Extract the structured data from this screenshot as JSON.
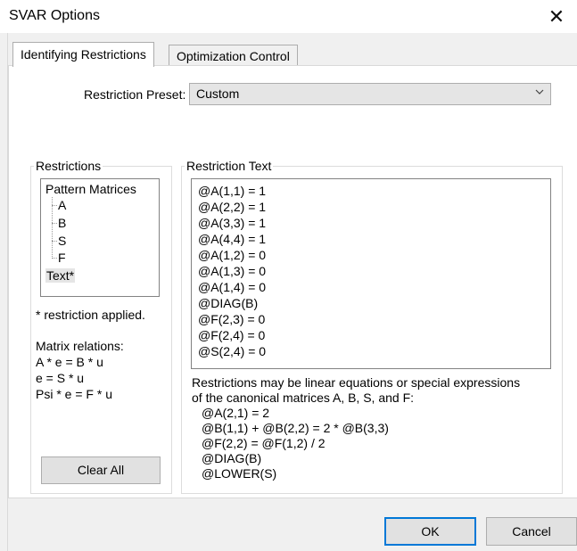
{
  "window": {
    "title": "SVAR Options",
    "close_glyph": "✕"
  },
  "tabs": [
    {
      "label": "Identifying Restrictions",
      "active": true
    },
    {
      "label": "Optimization Control",
      "active": false
    }
  ],
  "preset": {
    "label": "Restriction Preset:",
    "value": "Custom"
  },
  "restrictions_group": {
    "title": "Restrictions",
    "tree": {
      "root": "Pattern Matrices",
      "children": [
        "A",
        "B",
        "S",
        "F"
      ],
      "text_node": "Text*"
    },
    "applied_note": "* restriction applied.",
    "relations_title": "Matrix relations:",
    "relations": [
      "A * e = B * u",
      "e = S * u",
      "Psi * e = F * u"
    ],
    "clear_all_label": "Clear All"
  },
  "restriction_text_group": {
    "title": "Restriction Text",
    "lines": [
      "@A(1,1) = 1",
      "@A(2,2) = 1",
      "@A(3,3) = 1",
      "@A(4,4) = 1",
      "@A(1,2) = 0",
      "@A(1,3) = 0",
      "@A(1,4) = 0",
      "@DIAG(B)",
      "@F(2,3) = 0",
      "@F(2,4) = 0",
      "@S(2,4) = 0"
    ],
    "help_line1": "Restrictions may be linear equations or special expressions",
    "help_line2": "of the canonical matrices A, B, S, and F:",
    "examples": [
      "@A(2,1) = 2",
      "@B(1,1) + @B(2,2) = 2 * @B(3,3)",
      "@F(2,2) = @F(1,2) / 2",
      "@DIAG(B)",
      "@LOWER(S)"
    ]
  },
  "footer": {
    "ok_label": "OK",
    "cancel_label": "Cancel"
  },
  "colors": {
    "accent": "#0078d7",
    "button_bg": "#e1e1e1",
    "dialog_bg": "#f0f0f0"
  }
}
